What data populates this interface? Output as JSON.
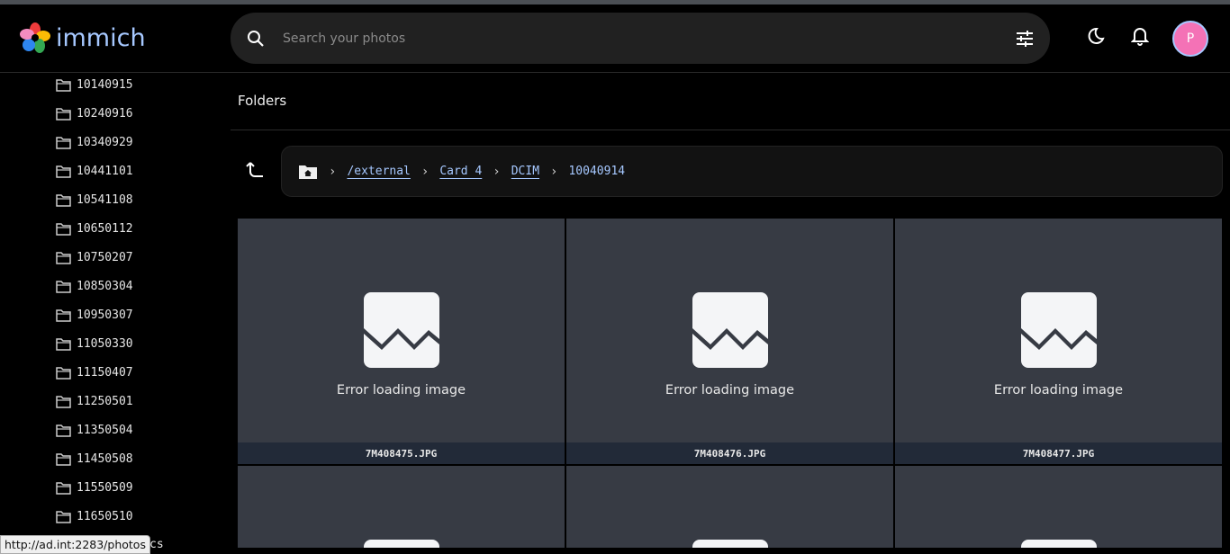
{
  "app": {
    "name": "immich"
  },
  "search": {
    "placeholder": "Search your photos"
  },
  "user": {
    "initial": "P"
  },
  "sidebar": {
    "folders": [
      "10140915",
      "10240916",
      "10340929",
      "10441101",
      "10541108",
      "10650112",
      "10750207",
      "10850304",
      "10950307",
      "11050330",
      "11150407",
      "11250501",
      "11350504",
      "11450508",
      "11550509",
      "11650510"
    ],
    "partial": "cs"
  },
  "page": {
    "title": "Folders"
  },
  "breadcrumb": {
    "items": [
      "/external",
      "Card 4",
      "DCIM"
    ],
    "current": "10040914"
  },
  "tiles": {
    "error_text": "Error loading image",
    "files": [
      "7M408475.JPG",
      "7M408476.JPG",
      "7M408477.JPG"
    ]
  },
  "status_bar": {
    "url": "http://ad.int:2283/photos"
  }
}
